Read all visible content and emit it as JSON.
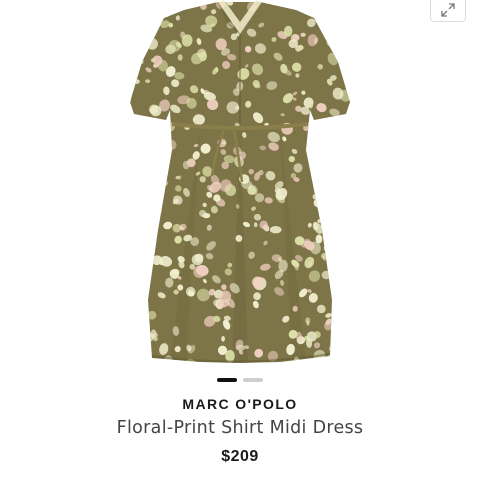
{
  "product": {
    "brand": "MARC O'POLO",
    "name": "Floral-Print Shirt Midi Dress",
    "price": "$209",
    "image_alt": "Floral-Print Shirt Midi Dress"
  },
  "carousel": {
    "total": 2,
    "active_index": 0
  },
  "controls": {
    "expand_icon": "expand-arrows-icon"
  },
  "colors": {
    "dress_base": "#7d7447",
    "dress_shadow": "#6a6239",
    "flower_light": "#f1efcf",
    "flower_mid": "#dde1a8",
    "flower_pink": "#f0cfc0",
    "active_dot": "#111111",
    "inactive_dot": "#cfcfcf"
  }
}
